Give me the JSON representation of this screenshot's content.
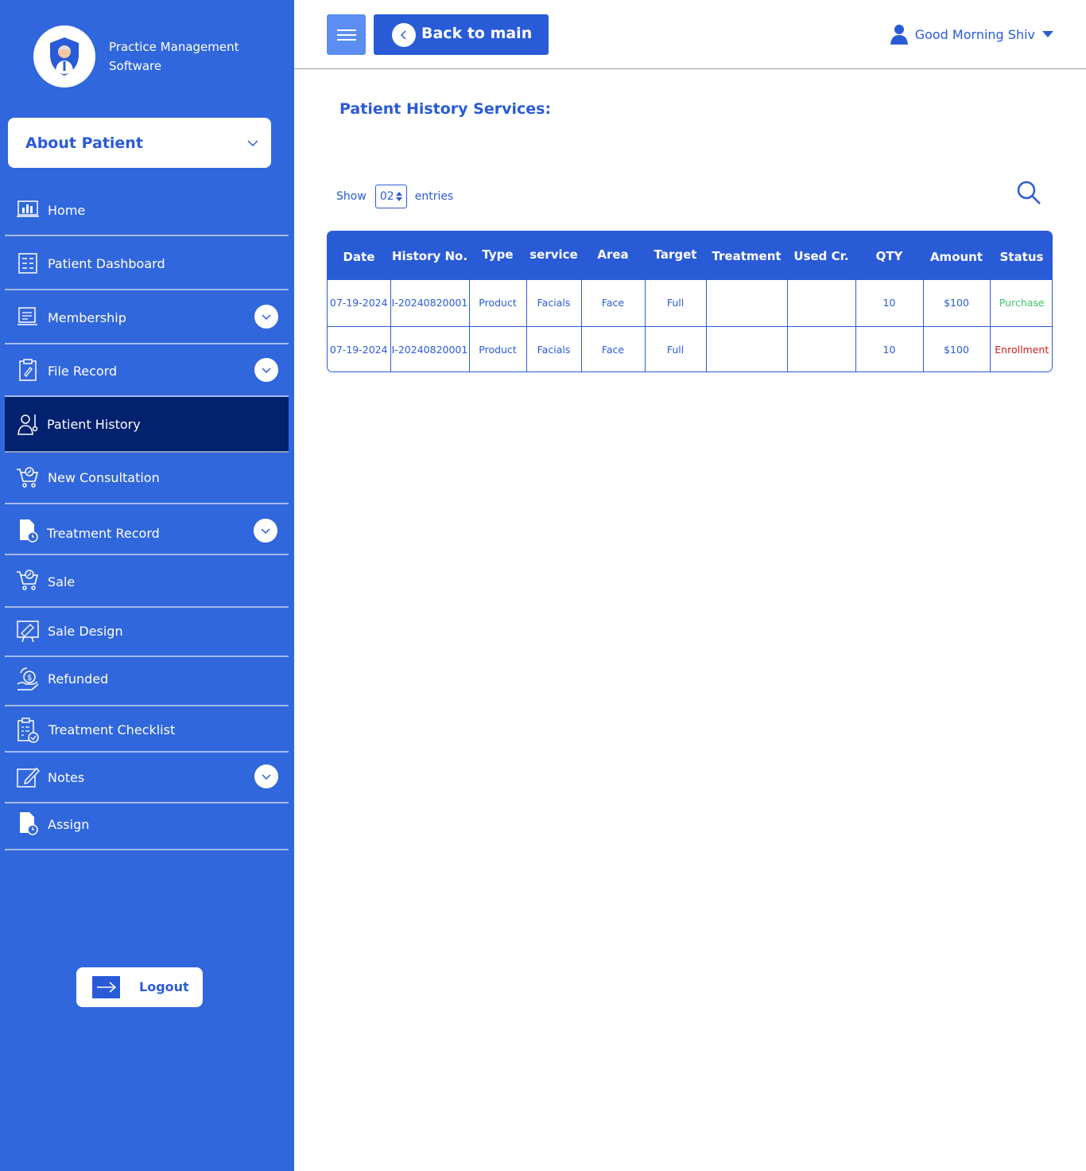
{
  "brand": {
    "name": "Practice Management Software"
  },
  "about_patient": {
    "label": "About Patient"
  },
  "sidebar": {
    "items": [
      {
        "label": "Home",
        "icon": "chart-icon",
        "has_dropdown": false,
        "active": false
      },
      {
        "label": "Patient Dashboard",
        "icon": "dashboard-icon",
        "has_dropdown": false,
        "active": false
      },
      {
        "label": "Membership",
        "icon": "membership-icon",
        "has_dropdown": true,
        "active": false
      },
      {
        "label": "File Record",
        "icon": "clipboard-icon",
        "has_dropdown": true,
        "active": false
      },
      {
        "label": "Patient History",
        "icon": "patient-icon",
        "has_dropdown": false,
        "active": true
      },
      {
        "label": "New Consultation",
        "icon": "cart-icon",
        "has_dropdown": false,
        "active": false
      },
      {
        "label": "Treatment Record",
        "icon": "document-clock-icon",
        "has_dropdown": true,
        "active": false
      },
      {
        "label": "Sale",
        "icon": "cart-icon",
        "has_dropdown": false,
        "active": false
      },
      {
        "label": "Sale Design",
        "icon": "design-board-icon",
        "has_dropdown": false,
        "active": false
      },
      {
        "label": "Refunded",
        "icon": "refund-icon",
        "has_dropdown": false,
        "active": false
      },
      {
        "label": "Treatment Checklist",
        "icon": "checklist-icon",
        "has_dropdown": false,
        "active": false
      },
      {
        "label": "Notes",
        "icon": "edit-icon",
        "has_dropdown": true,
        "active": false
      },
      {
        "label": "Assign",
        "icon": "document-clock-icon",
        "has_dropdown": false,
        "active": false
      }
    ],
    "logout_label": "Logout"
  },
  "header": {
    "back_label": "Back to main",
    "greeting": "Good Morning Shiv"
  },
  "main": {
    "title": "Patient History Services:",
    "show_label": "Show",
    "entries_value": "02",
    "entries_label": "entries",
    "table": {
      "columns": [
        "Date",
        "History No.",
        "Type",
        "service",
        "Area",
        "Target",
        "Treatment",
        "Used Cr.",
        "QTY",
        "Amount",
        "Status"
      ],
      "rows": [
        [
          "07-19-2024",
          "I-20240820001",
          "Product",
          "Facials",
          "Face",
          "Full",
          "",
          "",
          "10",
          "$100",
          "Purchase"
        ],
        [
          "07-19-2024",
          "I-20240820001",
          "Product",
          "Facials",
          "Face",
          "Full",
          "",
          "",
          "10",
          "$100",
          "Enrollment"
        ]
      ]
    }
  },
  "colors": {
    "primary": "#2a5bd7",
    "sidebar": "#3167dc",
    "active": "#02216e",
    "purchase": "#3cc46a",
    "enrollment": "#d41b1b"
  }
}
